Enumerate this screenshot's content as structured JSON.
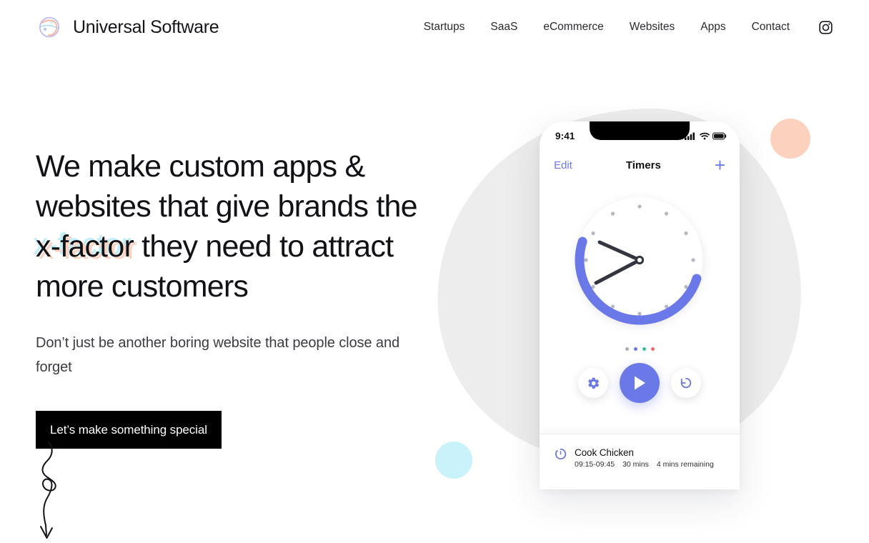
{
  "header": {
    "brand_name": "Universal Software",
    "logo_icon": "orb-logo-icon",
    "nav": [
      {
        "label": "Startups"
      },
      {
        "label": "SaaS"
      },
      {
        "label": "eCommerce"
      },
      {
        "label": "Websites"
      },
      {
        "label": "Apps"
      },
      {
        "label": "Contact"
      }
    ],
    "social_icon": "instagram-icon"
  },
  "hero": {
    "headline_part1": "We make custom apps & websites that give brands the ",
    "headline_highlight": "x-factor",
    "headline_part2": " they need to attract more customers",
    "subheading": "Don’t just be another boring website that people close and forget",
    "cta_label": "Let’s make something special",
    "squiggle_icon": "squiggle-arrow-icon"
  },
  "phone": {
    "status": {
      "time": "9:41",
      "signal_icon": "cellular-signal-icon",
      "wifi_icon": "wifi-icon",
      "battery_icon": "battery-icon"
    },
    "navbar": {
      "edit_label": "Edit",
      "title": "Timers",
      "add_label": "+"
    },
    "clock": {
      "marker_count": 12,
      "hand_icon": "clock-hands-icon",
      "progress_arc_icon": "timer-progress-arc-icon"
    },
    "page_dots": [
      {
        "color": "#a9abb5"
      },
      {
        "color": "#6b79e8"
      },
      {
        "color": "#34c38f"
      },
      {
        "color": "#f06a6a"
      }
    ],
    "controls": [
      {
        "name": "settings-button",
        "icon": "gear-icon"
      },
      {
        "name": "play-button",
        "icon": "play-icon"
      },
      {
        "name": "reset-button",
        "icon": "restore-counterclockwise-icon"
      }
    ],
    "timer_card": {
      "icon": "timer-circle-icon",
      "title": "Cook Chicken",
      "time_range": "09:15-09:45",
      "duration": "30 mins",
      "remaining": "4 mins remaining"
    }
  },
  "decor": {
    "blob_color": "#ededed",
    "peach_circle_color": "#fcd2bf",
    "cyan_circle_color": "#caf2fa"
  },
  "colors": {
    "accent_blue": "#6b79e8",
    "text_dark": "#111216",
    "button_bg": "#000000"
  }
}
